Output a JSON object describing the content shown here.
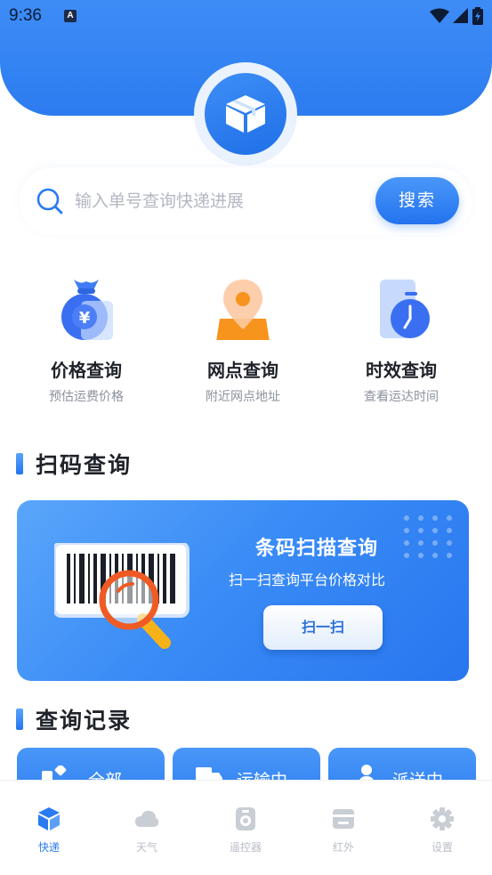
{
  "status_bar": {
    "time": "9:36",
    "notification_badge": "A"
  },
  "search": {
    "placeholder": "输入单号查询快递进展",
    "button_label": "搜索"
  },
  "functions": [
    {
      "title": "价格查询",
      "subtitle": "预估运费价格",
      "icon": "money-bag-icon"
    },
    {
      "title": "网点查询",
      "subtitle": "附近网点地址",
      "icon": "location-pin-icon"
    },
    {
      "title": "时效查询",
      "subtitle": "查看运达时间",
      "icon": "timer-icon"
    }
  ],
  "scan_section": {
    "title": "扫码查询",
    "card_title": "条码扫描查询",
    "card_subtitle": "扫一扫查询平台价格对比",
    "button_label": "扫一扫"
  },
  "records_section": {
    "title": "查询记录",
    "tabs": [
      {
        "label": "全部",
        "icon": "grid-icon"
      },
      {
        "label": "运输中",
        "icon": "truck-icon"
      },
      {
        "label": "派送中",
        "icon": "courier-icon"
      }
    ]
  },
  "tab_bar": {
    "items": [
      {
        "label": "快递",
        "icon": "package-icon",
        "active": true
      },
      {
        "label": "天气",
        "icon": "cloud-icon",
        "active": false
      },
      {
        "label": "遥控器",
        "icon": "remote-icon",
        "active": false
      },
      {
        "label": "红外",
        "icon": "infrared-icon",
        "active": false
      },
      {
        "label": "设置",
        "icon": "gear-icon",
        "active": false
      }
    ]
  },
  "colors": {
    "primary": "#2c7cf0",
    "accent_orange": "#f7941d",
    "text_dark": "#1f2329",
    "text_gray": "#8b919c"
  }
}
